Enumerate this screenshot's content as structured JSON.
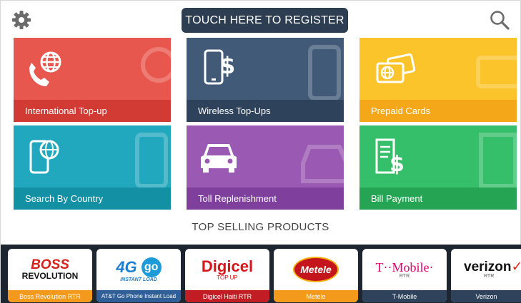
{
  "header": {
    "register_label": "TOUCH HERE TO REGISTER",
    "settings_icon": "gear-icon",
    "search_icon": "search-icon"
  },
  "tiles": [
    {
      "label": "International Top-up",
      "icon": "phone-globe-icon"
    },
    {
      "label": "Wireless Top-Ups",
      "icon": "phone-dollar-icon"
    },
    {
      "label": "Prepaid Cards",
      "icon": "cards-globe-icon"
    },
    {
      "label": "Search By Country",
      "icon": "phone-globe-search-icon"
    },
    {
      "label": "Toll Replenishment",
      "icon": "car-icon"
    },
    {
      "label": "Bill Payment",
      "icon": "bill-dollar-icon"
    }
  ],
  "section_title": "TOP SELLING PRODUCTS",
  "products": [
    {
      "caption": "Boss Revolution RTR",
      "logo_line1": "BOSS",
      "logo_line2": "REVOLUTION"
    },
    {
      "caption": "AT&T Go Phone Instant Load",
      "logo_line1": "4G",
      "logo_line2": "go",
      "logo_line3": "INSTANT LOAD"
    },
    {
      "caption": "Digicel Haiti RTR",
      "logo_line1": "Digicel",
      "logo_line2": "TOP UP"
    },
    {
      "caption": "Metele",
      "logo_line1": "Metele"
    },
    {
      "caption": "T-Mobile",
      "logo_line1": "T··Mobile·",
      "logo_line2": "RTR"
    },
    {
      "caption": "Verizon",
      "logo_line1": "verizon",
      "logo_line2": "RTR"
    }
  ],
  "colors": {
    "register_bg": "#2e3e52",
    "red": "#e8574e",
    "navy": "#405a78",
    "yellow": "#fbc42a",
    "teal": "#22a8be",
    "purple": "#9a59b2",
    "green": "#36bf6b"
  }
}
